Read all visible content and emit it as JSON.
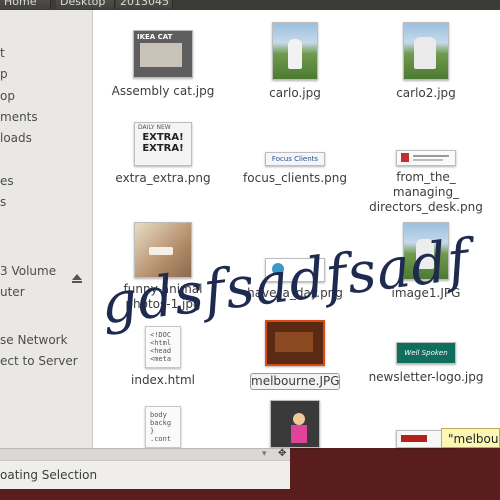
{
  "pathbar": {
    "crumbs": [
      "Home",
      "Desktop",
      "2013045"
    ]
  },
  "sidebar": {
    "items": [
      "t",
      "p",
      "op",
      "ments",
      "loads",
      "es",
      "s",
      "3 Volume",
      "uter",
      "se Network",
      "ect to Server"
    ]
  },
  "files": [
    {
      "name": "Assembly cat.jpg",
      "thumb_text": "IKEA CAT"
    },
    {
      "name": "carlo.jpg"
    },
    {
      "name": "carlo2.jpg"
    },
    {
      "name": "extra_extra.png",
      "thumb_text": [
        "DAILY NEW",
        "EXTRA!",
        "EXTRA!"
      ]
    },
    {
      "name": "focus_clients.png",
      "thumb_text": "Focus Clients"
    },
    {
      "name": "from_the_managing_directors_desk.png",
      "lines": [
        "from_the_",
        "managing_",
        "directors_desk.png"
      ]
    },
    {
      "name": "funny-animals-photos-1.jpg",
      "lines": [
        "funny-animal",
        "photos-1.jpg"
      ]
    },
    {
      "name": "have_a_day.png",
      "lines": [
        "have_a_day.png"
      ]
    },
    {
      "name": "image1.JPG",
      "lines": [
        "image1.JPG"
      ]
    },
    {
      "name": "index.html",
      "code": [
        "<!DOC",
        "<html",
        "<head",
        "<meta"
      ]
    },
    {
      "name": "melbourne.JPG",
      "selected": true
    },
    {
      "name": "newsletter-logo.jpg",
      "thumb_text": "Well Spoken"
    },
    {
      "code": [
        "body",
        "backg",
        "}",
        ".cont"
      ]
    }
  ],
  "status": {
    "text": "oating Selection"
  },
  "tooltip": {
    "text": "\"melbourne"
  },
  "watermark": {
    "text": "gdsfsadfsadf"
  },
  "colors": {
    "selection": "#dd4814",
    "sidebar_bg": "#e9e8e5",
    "desktop_bg": "#5a1d1d"
  }
}
